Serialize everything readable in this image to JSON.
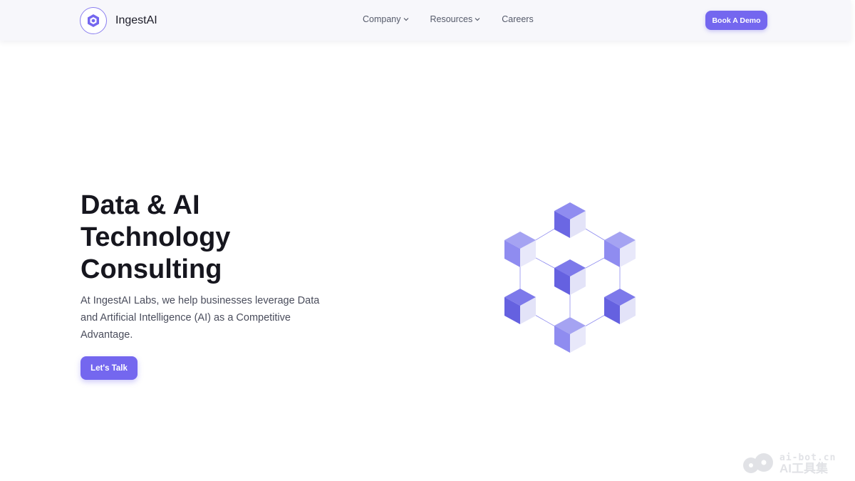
{
  "brand": {
    "name": "IngestAI",
    "logo_icon": "hexagon-logo-icon"
  },
  "nav": {
    "items": [
      {
        "label": "Company",
        "has_dropdown": true
      },
      {
        "label": "Resources",
        "has_dropdown": true
      },
      {
        "label": "Careers",
        "has_dropdown": false
      }
    ],
    "cta_label": "Book A Demo"
  },
  "hero": {
    "title_lines": [
      "Data & AI",
      "Technology",
      "Consulting"
    ],
    "subtitle": "At IngestAI Labs, we help businesses leverage Data and Artificial Intelligence (AI) as a Competitive Advantage.",
    "cta_label": "Let's Talk",
    "illustration": "isometric-cube-network-illustration"
  },
  "watermark": {
    "domain": "ai-bot.cn",
    "name": "AI工具集"
  },
  "colors": {
    "accent": "#7467ef",
    "cube_top": "#8f8cf0",
    "cube_left": "#6b67e3",
    "cube_right": "#e3e3f8",
    "header_bg": "#f7f7fb"
  }
}
